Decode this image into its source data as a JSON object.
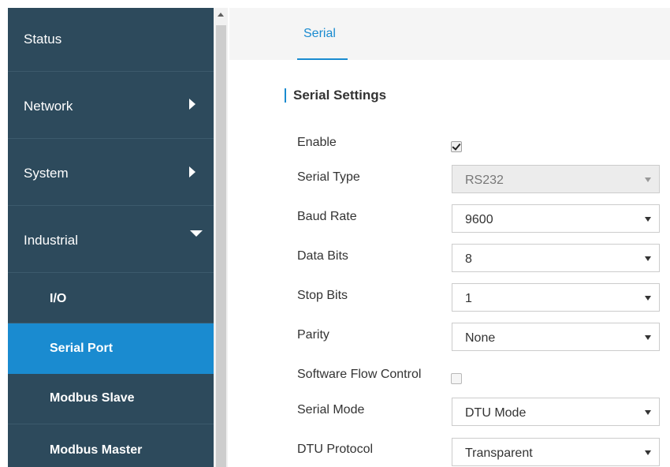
{
  "sidebar": {
    "items": [
      {
        "label": "Status"
      },
      {
        "label": "Network"
      },
      {
        "label": "System"
      },
      {
        "label": "Industrial"
      }
    ],
    "subitems": [
      {
        "label": "I/O"
      },
      {
        "label": "Serial Port"
      },
      {
        "label": "Modbus Slave"
      },
      {
        "label": "Modbus Master"
      }
    ]
  },
  "tabs": [
    {
      "label": "Serial"
    }
  ],
  "section": {
    "title": "Serial Settings"
  },
  "form": {
    "enable": {
      "label": "Enable",
      "checked": true
    },
    "serial_type": {
      "label": "Serial Type",
      "value": "RS232",
      "disabled": true
    },
    "baud_rate": {
      "label": "Baud Rate",
      "value": "9600"
    },
    "data_bits": {
      "label": "Data Bits",
      "value": "8"
    },
    "stop_bits": {
      "label": "Stop Bits",
      "value": "1"
    },
    "parity": {
      "label": "Parity",
      "value": "None"
    },
    "software_flow_control": {
      "label": "Software Flow Control",
      "checked": false
    },
    "serial_mode": {
      "label": "Serial Mode",
      "value": "DTU Mode"
    },
    "dtu_protocol": {
      "label": "DTU Protocol",
      "value": "Transparent"
    }
  },
  "colors": {
    "sidebar_bg": "#2d4a5c",
    "accent": "#1a8bd0"
  }
}
